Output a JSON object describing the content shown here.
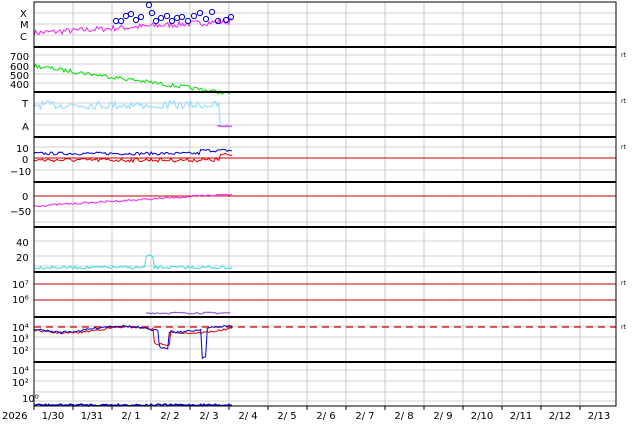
{
  "chart_data": {
    "type": "line",
    "x_year_label": "2026",
    "x_ticks": [
      "1/30",
      "1/31",
      "2/ 1",
      "2/ 2",
      "2/ 3",
      "2/ 4",
      "2/ 5",
      "2/ 6",
      "2/ 7",
      "2/ 8",
      "2/ 9",
      "2/10",
      "2/11",
      "2/12",
      "2/13"
    ],
    "data_end_date": "2/ 3",
    "grid": true,
    "side_marker": "rt",
    "colors": {
      "magenta": "#ee22ee",
      "blue": "#0000cc",
      "green": "#00dd00",
      "lightblue": "#99ddff",
      "red": "#dd0000",
      "cyan": "#33dddd",
      "purple": "#8844cc",
      "refline": "#cc0000"
    },
    "panels": [
      {
        "id": "class",
        "y_labels": [
          "X",
          "M",
          "C"
        ],
        "series": [
          "magenta",
          "blue"
        ]
      },
      {
        "id": "speed",
        "y_labels": [
          "700",
          "600",
          "500",
          "400"
        ],
        "series": [
          "green"
        ]
      },
      {
        "id": "mag",
        "y_labels": [
          "T",
          "A"
        ],
        "series": [
          "lightblue",
          "magenta"
        ]
      },
      {
        "id": "bz",
        "y_labels": [
          "10",
          "0",
          "−10"
        ],
        "series": [
          "blue",
          "red"
        ],
        "ref": 0
      },
      {
        "id": "dst",
        "y_labels": [
          "0",
          "−50"
        ],
        "series": [
          "magenta"
        ],
        "ref": 0
      },
      {
        "id": "density",
        "y_labels": [
          "40",
          "20"
        ],
        "series": [
          "cyan"
        ]
      },
      {
        "id": "electron",
        "y_labels": [
          "10⁷",
          "10⁶"
        ],
        "series": [
          "purple"
        ],
        "refs": [
          10000000.0,
          1000000.0
        ]
      },
      {
        "id": "proton",
        "y_labels": [
          "10⁴",
          "10³",
          "10²"
        ],
        "series": [
          "red",
          "blue"
        ],
        "ref": 10000.0
      },
      {
        "id": "flux",
        "y_labels": [
          "10⁴",
          "10²",
          "10⁰"
        ],
        "series": [
          "blue"
        ]
      }
    ]
  }
}
